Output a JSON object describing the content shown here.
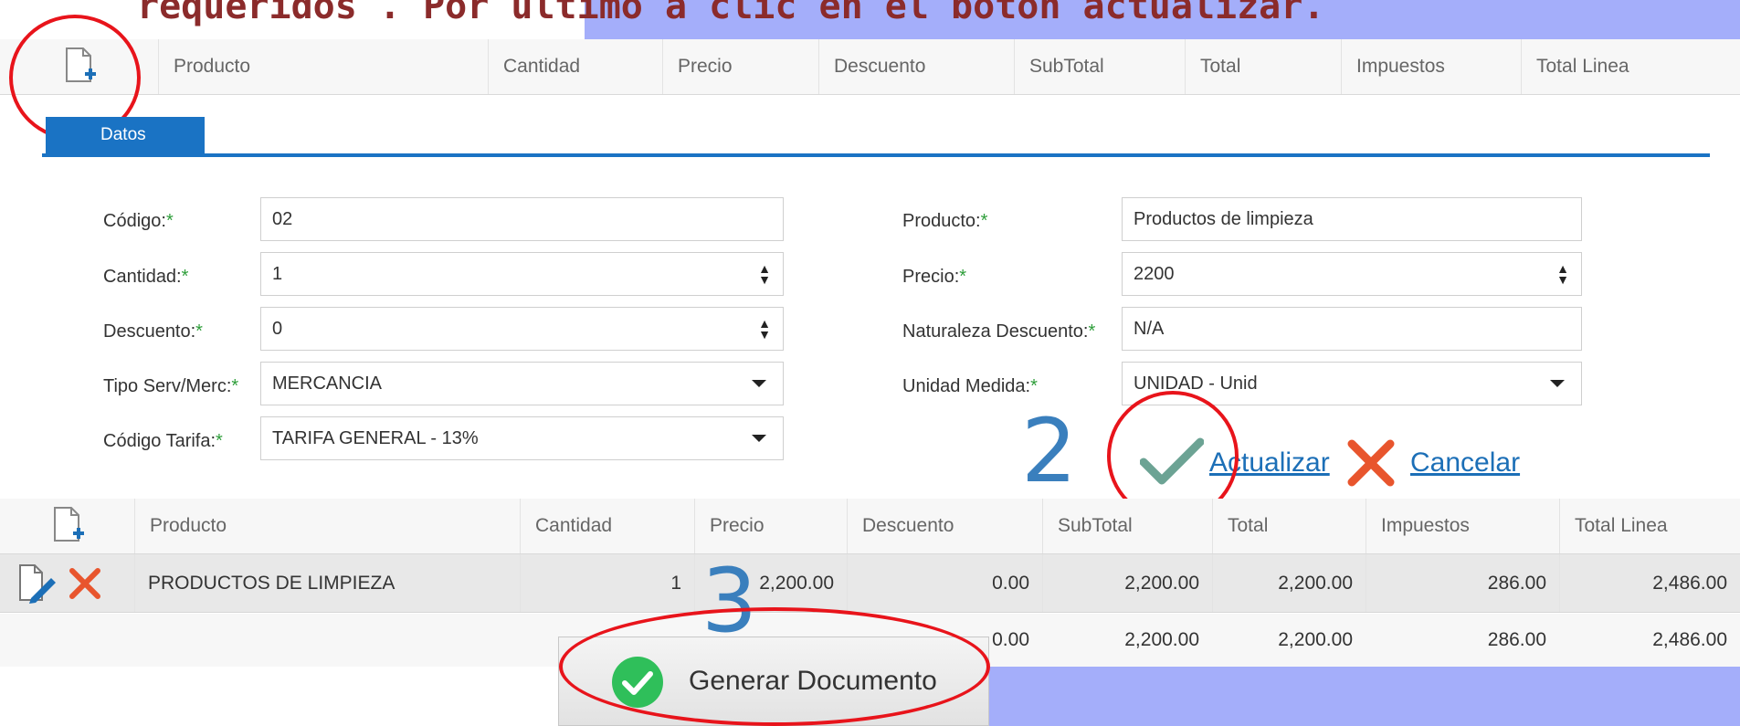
{
  "instruction": "requeridos . Por último a clic en el botón actualizar.",
  "top_grid": {
    "columns": [
      "Producto",
      "Cantidad",
      "Precio",
      "Descuento",
      "SubTotal",
      "Total",
      "Impuestos",
      "Total Linea"
    ]
  },
  "tabs": {
    "datos": "Datos"
  },
  "form": {
    "codigo": {
      "label": "Código:",
      "value": "02"
    },
    "cantidad": {
      "label": "Cantidad:",
      "value": "1"
    },
    "descuento": {
      "label": "Descuento:",
      "value": "0"
    },
    "tipo": {
      "label": "Tipo Serv/Merc:",
      "value": "MERCANCIA"
    },
    "tarifa": {
      "label": "Código Tarifa:",
      "value": "TARIFA GENERAL - 13%"
    },
    "producto": {
      "label": "Producto:",
      "value": "Productos de limpieza"
    },
    "precio": {
      "label": "Precio:",
      "value": "2200"
    },
    "naturaleza": {
      "label": "Naturaleza Descuento:",
      "value": "N/A"
    },
    "unidad": {
      "label": "Unidad Medida:",
      "value": "UNIDAD - Unid"
    },
    "required_mark": "*"
  },
  "actions": {
    "update": "Actualizar",
    "cancel": "Cancelar"
  },
  "steps": {
    "two": "2",
    "three": "3"
  },
  "bottom_grid": {
    "columns": [
      "Producto",
      "Cantidad",
      "Precio",
      "Descuento",
      "SubTotal",
      "Total",
      "Impuestos",
      "Total Linea"
    ],
    "row": {
      "producto": "PRODUCTOS DE LIMPIEZA",
      "cantidad": "1",
      "precio": "2,200.00",
      "descuento": "0.00",
      "subtotal": "2,200.00",
      "total": "2,200.00",
      "impuestos": "286.00",
      "total_linea": "2,486.00"
    },
    "totals": {
      "descuento": "0.00",
      "subtotal": "2,200.00",
      "total": "2,200.00",
      "impuestos": "286.00",
      "total_linea": "2,486.00"
    }
  },
  "generate_button": "Generar Documento",
  "colors": {
    "accent": "#1a73c4",
    "annotation_red": "#e8141b",
    "banner": "#a4aefa",
    "step_blue": "#3a7fbd"
  }
}
